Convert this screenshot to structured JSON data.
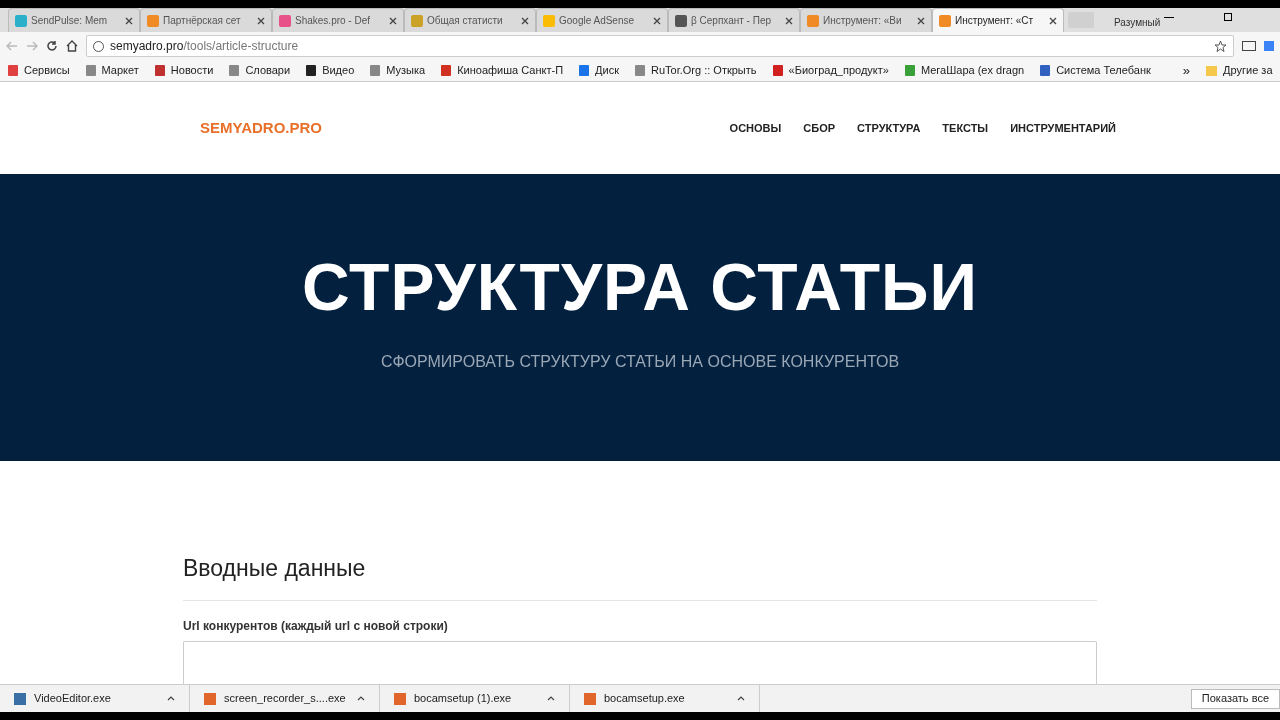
{
  "tabs": [
    {
      "title": "SendPulse: Mem",
      "selected": false
    },
    {
      "title": "Партнёрская сет",
      "selected": false
    },
    {
      "title": "Shakes.pro - Def",
      "selected": false
    },
    {
      "title": "Общая статисти",
      "selected": false
    },
    {
      "title": "Google AdSense",
      "selected": false
    },
    {
      "title": "β Серпхант - Пер",
      "selected": false
    },
    {
      "title": "Инструмент: «Ви",
      "selected": false
    },
    {
      "title": "Инструмент: «Ст",
      "selected": true
    }
  ],
  "profile": "Разумный",
  "address": {
    "host": "semyadro.pro",
    "path": "/tools/article-structure"
  },
  "bookmarks": [
    "Сервисы",
    "Маркет",
    "Новости",
    "Словари",
    "Видео",
    "Музыка",
    "Киноафиша Санкт-П",
    "Диск",
    "RuTor.Org :: Открыть",
    "«Биоград_продукт»",
    "МегаШара (ex dragn",
    "Система Телебанк"
  ],
  "bookmarks_more": "»",
  "other_bookmarks": "Другие за",
  "site": {
    "logo": "SEMYADRO.PRO",
    "nav": [
      "ОСНОВЫ",
      "СБОР",
      "СТРУКТУРА",
      "ТЕКСТЫ",
      "ИНСТРУМЕНТАРИЙ"
    ]
  },
  "hero": {
    "title": "СТРУКТУРА СТАТЬИ",
    "subtitle": "СФОРМИРОВАТЬ СТРУКТУРУ СТАТЬИ НА ОСНОВЕ КОНКУРЕНТОВ"
  },
  "form": {
    "heading": "Вводные данные",
    "label": "Url конкурентов (каждый url с новой строки)"
  },
  "downloads": [
    "VideoEditor.exe",
    "screen_recorder_s....exe",
    "bocamsetup (1).exe",
    "bocamsetup.exe"
  ],
  "show_all": "Показать все"
}
